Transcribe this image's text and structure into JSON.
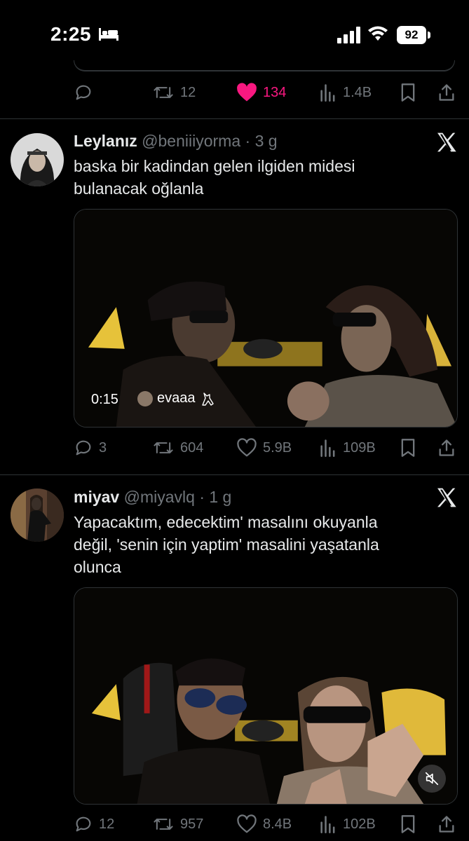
{
  "status_bar": {
    "time": "2:25",
    "battery": "92",
    "icons": [
      "bed-icon",
      "signal-icon",
      "wifi-icon",
      "battery-icon"
    ]
  },
  "colors": {
    "background": "#000000",
    "text": "#e7e9ea",
    "muted": "#71767b",
    "like": "#f91880",
    "divider": "#2f3336"
  },
  "previous_tweet": {
    "actions": {
      "replies": "",
      "retweets": "12",
      "likes": "134",
      "views": "1.4B"
    },
    "liked": true
  },
  "tweets": [
    {
      "name": "Leylanız",
      "handle": "@beniiiyorma",
      "time": "· 3 g",
      "text_lines": [
        "baska bir kadindan gelen ilgiden midesi",
        "bulanacak oğlanla"
      ],
      "video": {
        "timestamp": "0:15",
        "username": "evaaa",
        "username_icon": "cat-icon"
      },
      "actions": {
        "replies": "3",
        "retweets": "604",
        "likes": "5.9B",
        "views": "109B"
      }
    },
    {
      "name": "miyav",
      "handle": "@miyavlq",
      "time": "· 1 g",
      "text_lines": [
        "Yapacaktım, edecektim' masalını okuyanla",
        "değil, 'senin için yaptim' masalini yaşatanla",
        "olunca"
      ],
      "video": {
        "mute_icon": "muted-speaker-icon"
      },
      "actions": {
        "replies": "12",
        "retweets": "957",
        "likes": "8.4B",
        "views": "102B"
      }
    }
  ]
}
